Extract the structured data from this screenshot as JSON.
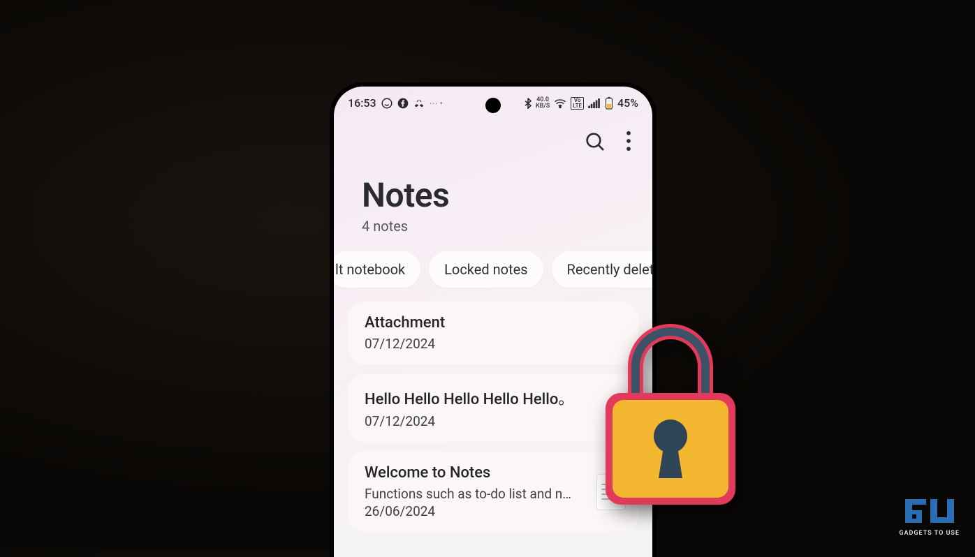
{
  "status": {
    "time": "16:53",
    "net_speed_top": "40.0",
    "net_speed_bottom": "KB/S",
    "volte": "Vo\nLTE",
    "battery": "45%"
  },
  "header": {
    "title": "Notes",
    "subtitle": "4 notes"
  },
  "chips": [
    "lt notebook",
    "Locked notes",
    "Recently deleted"
  ],
  "notes": [
    {
      "title": "Attachment",
      "desc": "",
      "date": "07/12/2024",
      "thumb": false
    },
    {
      "title": "Hello Hello Hello Hello Hello。",
      "desc": "",
      "date": "07/12/2024",
      "thumb": false
    },
    {
      "title": "Welcome to Notes",
      "desc": "Functions such as to-do list and n…",
      "date": "26/06/2024",
      "thumb": true
    }
  ],
  "logo": {
    "text": "GADGETS TO USE"
  }
}
